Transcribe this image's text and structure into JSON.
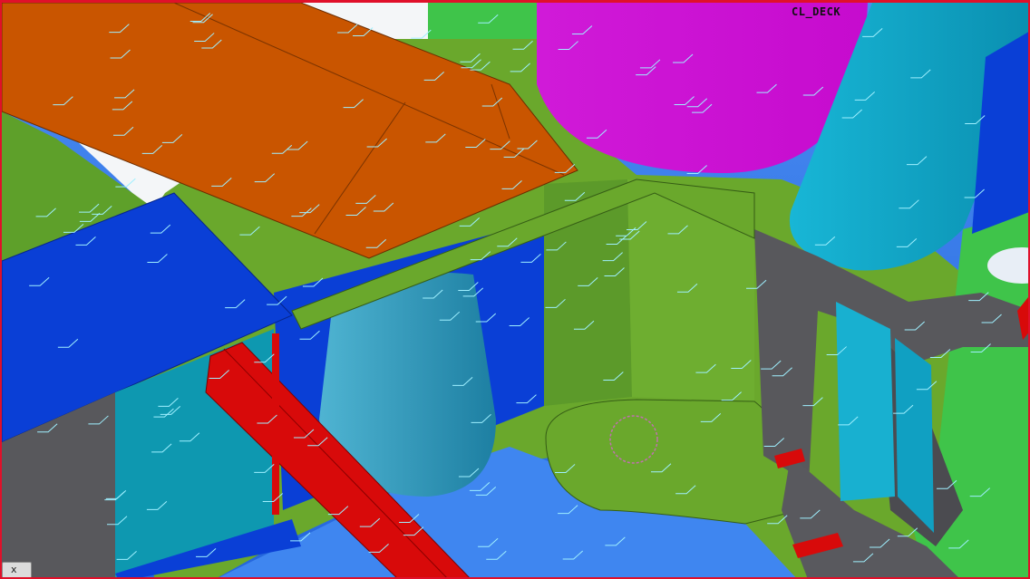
{
  "viewport": {
    "plane_label": "CL_DECK",
    "close_tab_label": "x"
  },
  "colors": {
    "frame": "#e0102a",
    "deck_green": "#6aa82c",
    "bright_green": "#3fc44a",
    "orange_plate": "#c95500",
    "blue_plate": "#0a3fd6",
    "magenta_pipe": "#d414d8",
    "cyan_pipe": "#12a6c8",
    "teal_pipe": "#2f93b3",
    "red_beam": "#d80a0a",
    "grey_web": "#58585c",
    "sky_blue": "#3a7df0",
    "weld_marks": "#9ff0ff"
  }
}
